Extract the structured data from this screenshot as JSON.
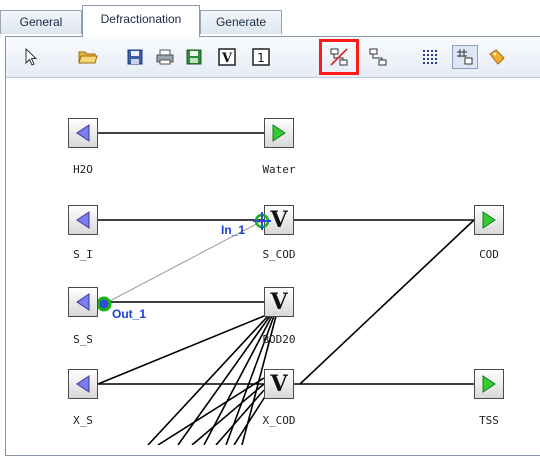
{
  "tabs": [
    {
      "label": "General"
    },
    {
      "label": "Defractionation"
    },
    {
      "label": "Generate"
    }
  ],
  "toolbar": {
    "icons": [
      "pointer-icon",
      "open-folder-icon",
      "save-icon",
      "print-icon",
      "export-icon",
      "v-box-icon",
      "one-box-icon",
      "link-edit-icon",
      "link-tool-icon",
      "grid-icon",
      "snap-icon",
      "tag-icon"
    ],
    "v_glyph": "V",
    "one_glyph": "1"
  },
  "nodes": {
    "h2o": {
      "label": "H2O"
    },
    "water": {
      "label": "Water"
    },
    "s_i": {
      "label": "S_I"
    },
    "s_cod": {
      "label": "S_COD"
    },
    "cod": {
      "label": "COD"
    },
    "s_s": {
      "label": "S_S"
    },
    "bod20": {
      "label": "BOD20"
    },
    "x_s": {
      "label": "X_S"
    },
    "x_cod": {
      "label": "X_COD"
    },
    "tss": {
      "label": "TSS"
    },
    "v_glyph": "V"
  },
  "ports": {
    "in_1": "In_1",
    "out_1": "Out_1"
  },
  "colors": {
    "input_arrow": "#7d7df0",
    "output_arrow": "#33cc33",
    "port_label": "#1a3fd6",
    "highlight": "#ff1a1a"
  }
}
